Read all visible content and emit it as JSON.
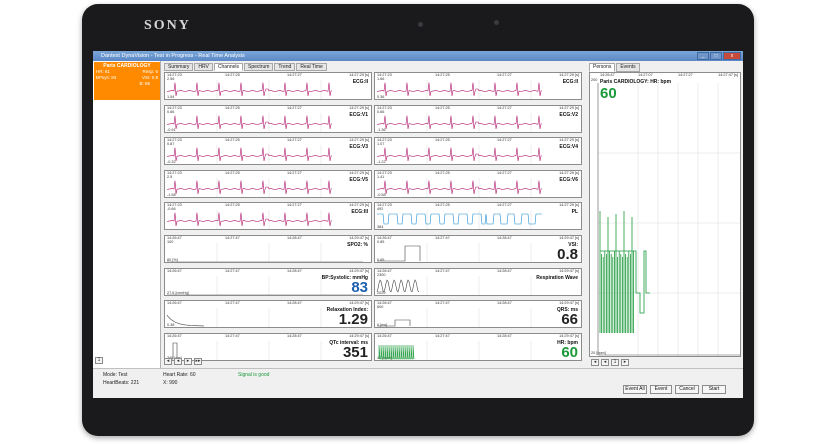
{
  "device": {
    "brand": "SONY"
  },
  "window": {
    "title": "Dantest DynaVision - Test in Progress - Real Time Analysis",
    "min": "_",
    "max": "□",
    "close": "x"
  },
  "patient": {
    "name": "Paris CARDIOLOGY",
    "hr": "HR: 61",
    "resp": "Resp: 6",
    "bpsys": "BPsys: 84",
    "vsi": "VSI: 0.8",
    "b": "B: 86"
  },
  "tabs": [
    "Summary",
    "HRV",
    "Channels",
    "Spectrum",
    "Trend",
    "Real Time"
  ],
  "colors": {
    "ecg": "#b0186a",
    "pl": "#1a8fd0",
    "value_blue": "#1f5fb0",
    "value_green": "#1a9a3a",
    "patient_bg": "#ff8a00"
  },
  "panels": [
    {
      "name": "ECG:II",
      "t0": "14:27:23",
      "t1": "14:27:25",
      "t2": "14:27:27",
      "t3": "14:27:29 [s]",
      "top": "2.56",
      "bottom": "1.54",
      "kind": "ecg"
    },
    {
      "name": "ECG:II",
      "t0": "14:27:23",
      "t1": "14:27:25",
      "t2": "14:27:27",
      "t3": "14:27:29 [s]",
      "top": "1.66",
      "bottom": "0.36",
      "kind": "ecg"
    },
    {
      "name": "ECG:V1",
      "t0": "14:27:23",
      "t1": "14:27:25",
      "t2": "14:27:27",
      "t3": "14:27:29 [s]",
      "top": "0.66",
      "bottom": "-0.91",
      "kind": "ecg"
    },
    {
      "name": "ECG:V2",
      "t0": "14:27:23",
      "t1": "14:27:25",
      "t2": "14:27:27",
      "t3": "14:27:29 [s]",
      "top": "0.66",
      "bottom": "-1.36",
      "kind": "ecg"
    },
    {
      "name": "ECG:V3",
      "t0": "14:27:23",
      "t1": "14:27:25",
      "t2": "14:27:27",
      "t3": "14:27:29 [s]",
      "top": "0.87",
      "bottom": "-0.32",
      "kind": "ecg"
    },
    {
      "name": "ECG:V4",
      "t0": "14:27:23",
      "t1": "14:27:25",
      "t2": "14:27:27",
      "t3": "14:27:29 [s]",
      "top": "1.07",
      "bottom": "-1.22",
      "kind": "ecg"
    },
    {
      "name": "ECG:V5",
      "t0": "14:27:23",
      "t1": "14:27:25",
      "t2": "14:27:27",
      "t3": "14:27:29 [s]",
      "top": "2.5",
      "bottom": "-1.58",
      "kind": "ecg"
    },
    {
      "name": "ECG:V6",
      "t0": "14:27:23",
      "t1": "14:27:25",
      "t2": "14:27:27",
      "t3": "14:27:29 [s]",
      "top": "1.41",
      "bottom": "-0.58",
      "kind": "ecg"
    },
    {
      "name": "ECG:III",
      "t0": "14:27:23",
      "t1": "14:27:25",
      "t2": "14:27:27",
      "t3": "14:27:29 [s]",
      "top": "-0.66",
      "bottom": "",
      "kind": "ecg"
    },
    {
      "name": "PL",
      "t0": "14:27:23",
      "t1": "14:27:25",
      "t2": "14:27:27",
      "t3": "14:27:29 [s]",
      "top": "492",
      "bottom": "384",
      "kind": "pl"
    },
    {
      "name": "SPO2: %",
      "t0": "14:26:47",
      "t1": "14:27:47",
      "t2": "14:28:47",
      "t3": "14:29:47 [s]",
      "top": "100",
      "bottom": "80 [%]",
      "kind": "flat",
      "value": "",
      "color": ""
    },
    {
      "name": "VSI:",
      "t0": "14:26:47",
      "t1": "14:27:47",
      "t2": "14:28:47",
      "t3": "14:29:47 [s]",
      "top": "0.85",
      "bottom": "0.65",
      "kind": "step",
      "value": "0.8",
      "color": ""
    },
    {
      "name": "BP:Systolic: mmHg",
      "t0": "14:26:47",
      "t1": "14:27:47",
      "t2": "14:28:47",
      "t3": "14:29:47 [s]",
      "top": "",
      "bottom": "27.6 [mmHg]",
      "kind": "flat",
      "value": "83",
      "color": "blue"
    },
    {
      "name": "Respiration Wave",
      "t0": "14:26:47",
      "t1": "14:27:47",
      "t2": "14:28:47",
      "t3": "14:29:47 [s]",
      "top": "2300",
      "bottom": "2029",
      "kind": "resp",
      "value": "",
      "color": ""
    },
    {
      "name": "Relaxation Index:",
      "t0": "14:26:47",
      "t1": "14:27:47",
      "t2": "14:28:47",
      "t3": "14:29:47 [s]",
      "top": "",
      "bottom": "0.38",
      "kind": "decay",
      "value": "1.29",
      "color": ""
    },
    {
      "name": "QRS: ms",
      "t0": "14:26:47",
      "t1": "14:27:47",
      "t2": "14:28:47",
      "t3": "14:29:47 [s]",
      "top": "600",
      "bottom": "0 [ms]",
      "kind": "qrs",
      "value": "66",
      "color": ""
    },
    {
      "name": "QTc interval: ms",
      "t0": "14:26:47",
      "t1": "14:27:47",
      "t2": "14:28:47",
      "t3": "14:29:47 [s]",
      "top": "",
      "bottom": "345 [ms]",
      "kind": "qtc",
      "value": "351",
      "color": ""
    },
    {
      "name": "HR: bpm",
      "t0": "14:26:47",
      "t1": "14:27:47",
      "t2": "14:28:47",
      "t3": "14:29:47 [s]",
      "top": "",
      "bottom": "40 [bpm]",
      "kind": "hr",
      "value": "60",
      "color": "green"
    }
  ],
  "right": {
    "tabs": [
      "Persons",
      "Events"
    ],
    "title": "Paris CARDIOLOGY: HR: bpm",
    "value": "60",
    "t0": "14:26:47",
    "t1": "14:27:07",
    "t2": "14:27:27",
    "t3": "14:27:47 [s]",
    "top": "200",
    "bottom": "20 [bpm]"
  },
  "status": {
    "mode": "Mode: Test",
    "heartbeats": "HeartBeats: 221",
    "heartrate": "Heart Rate: 60",
    "x": "X: 990",
    "signal": "Signal is good"
  },
  "actions": {
    "event_all": "Event All",
    "event": "Event",
    "cancel": "Cancel",
    "start": "Start"
  },
  "nav": {
    "first": "◂",
    "prev": "◂",
    "next": "▸",
    "last": "▸▸",
    "page": "1"
  }
}
